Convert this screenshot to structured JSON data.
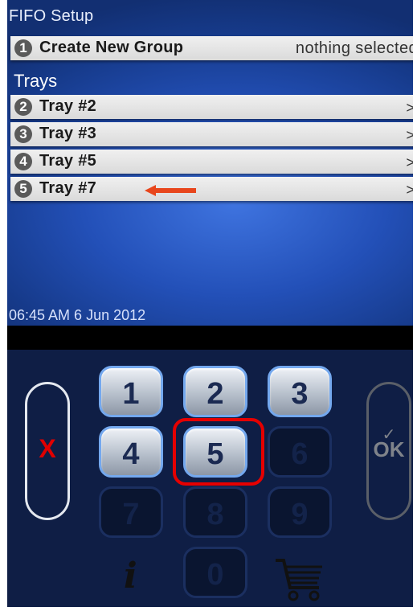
{
  "screen": {
    "title": "FIFO Setup",
    "create_row": {
      "number": "1",
      "label": "Create New Group",
      "value": "nothing selected"
    },
    "section_label": "Trays",
    "trays": [
      {
        "number": "2",
        "label": "Tray #2",
        "chevron": ">"
      },
      {
        "number": "3",
        "label": "Tray #3",
        "chevron": ">"
      },
      {
        "number": "4",
        "label": "Tray #5",
        "chevron": ">"
      },
      {
        "number": "5",
        "label": "Tray #7",
        "chevron": ">"
      }
    ],
    "timestamp": "06:45 AM 6 Jun 2012"
  },
  "keypad": {
    "keys": [
      {
        "label": "1",
        "enabled": true
      },
      {
        "label": "2",
        "enabled": true
      },
      {
        "label": "3",
        "enabled": true
      },
      {
        "label": "4",
        "enabled": true
      },
      {
        "label": "5",
        "enabled": true
      },
      {
        "label": "6",
        "enabled": false
      },
      {
        "label": "7",
        "enabled": false
      },
      {
        "label": "8",
        "enabled": false
      },
      {
        "label": "9",
        "enabled": false
      },
      {
        "label": "0",
        "enabled": false
      }
    ],
    "highlighted_key": "5",
    "cancel_label": "X",
    "ok_label": "OK",
    "ok_check": "✓",
    "info_label": "i",
    "icons": [
      "info-icon",
      "cart-icon",
      "annotation-arrow-icon"
    ]
  },
  "colors": {
    "screen_blue": "#2350b8",
    "annotation_red": "#e60000",
    "key_border_blue": "#74a8ee",
    "panel_navy": "#0f1e45"
  }
}
